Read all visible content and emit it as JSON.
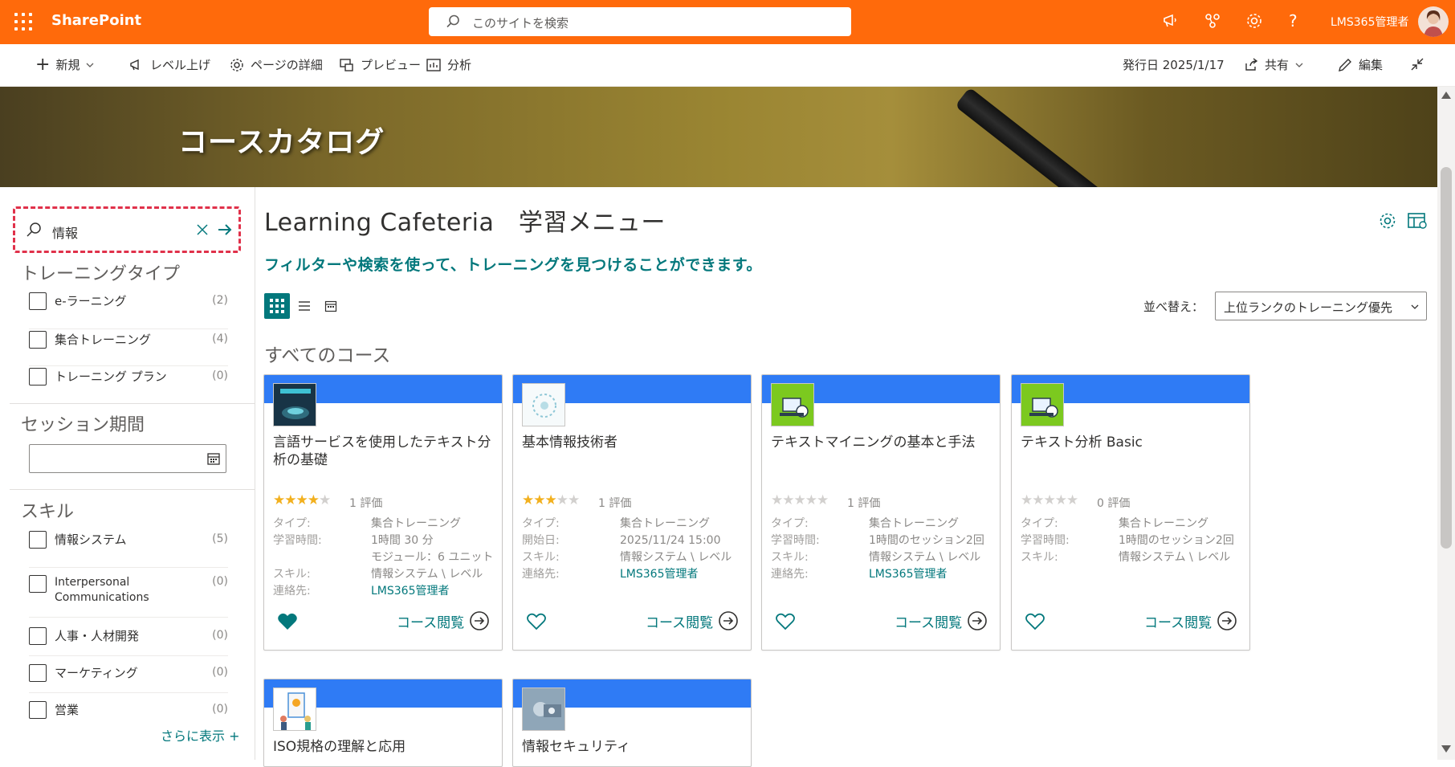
{
  "suitebar": {
    "app_name": "SharePoint",
    "search_placeholder": "このサイトを検索",
    "user_name": "LMS365管理者",
    "icons": [
      "megaphone-icon",
      "network-icon",
      "gear-icon",
      "help-icon"
    ]
  },
  "commandbar": {
    "new_label": "新規",
    "level_up_label": "レベル上げ",
    "page_details_label": "ページの詳細",
    "preview_label": "プレビュー",
    "analytics_label": "分析",
    "published_label": "発行日 2025/1/17",
    "share_label": "共有",
    "edit_label": "編集"
  },
  "hero": {
    "title": "コースカタログ"
  },
  "filters": {
    "search_value": "情報",
    "training_type": {
      "heading": "トレーニングタイプ",
      "items": [
        {
          "label": "e-ラーニング",
          "count": "(2)"
        },
        {
          "label": "集合トレーニング",
          "count": "(4)"
        },
        {
          "label": "トレーニング プラン",
          "count": "(0)"
        }
      ]
    },
    "session_period": {
      "heading": "セッション期間"
    },
    "skills": {
      "heading": "スキル",
      "items": [
        {
          "label": "情報システム",
          "count": "(5)"
        },
        {
          "label": "Interpersonal Communications",
          "count": "(0)"
        },
        {
          "label": "人事・人材開発",
          "count": "(0)"
        },
        {
          "label": "マーケティング",
          "count": "(0)"
        },
        {
          "label": "営業",
          "count": "(0)"
        }
      ],
      "more_label": "さらに表示 +"
    }
  },
  "main": {
    "title": "Learning Cafeteria　学習メニュー",
    "subtitle": "フィルターや検索を使って、トレーニングを見つけることができます。",
    "sort_label": "並べ替え：",
    "sort_value": "上位ランクのトレーニング優先",
    "section_title": "すべてのコース",
    "view_label": "コース閲覧",
    "courses": [
      {
        "title": "言語サービスを使用したテキスト分析の基礎",
        "stars": 4,
        "rating_text": "1 評価",
        "meta": [
          {
            "k": "タイプ:",
            "v": "集合トレーニング"
          },
          {
            "k": "学習時間:",
            "v": "1時間 30 分"
          },
          {
            "k": "",
            "v": "モジュール：6 ユニット"
          },
          {
            "k": "スキル:",
            "v": "情報システム \\ レベル"
          },
          {
            "k": "連絡先:",
            "v": "LMS365管理者"
          }
        ],
        "favorite": true
      },
      {
        "title": "基本情報技術者",
        "stars": 3,
        "rating_text": "1 評価",
        "meta": [
          {
            "k": "タイプ:",
            "v": "集合トレーニング"
          },
          {
            "k": "開始日:",
            "v": "2025/11/24 15:00"
          },
          {
            "k": "スキル:",
            "v": "情報システム \\ レベル"
          },
          {
            "k": "連絡先:",
            "v": "LMS365管理者"
          }
        ],
        "favorite": false
      },
      {
        "title": "テキストマイニングの基本と手法",
        "stars": 0,
        "rating_text": "1 評価",
        "meta": [
          {
            "k": "タイプ:",
            "v": "集合トレーニング"
          },
          {
            "k": "学習時間:",
            "v": "1時間のセッション2回"
          },
          {
            "k": "スキル:",
            "v": "情報システム \\ レベル"
          },
          {
            "k": "連絡先:",
            "v": "LMS365管理者"
          }
        ],
        "favorite": false
      },
      {
        "title": "テキスト分析 Basic",
        "stars": 0,
        "rating_text": "0 評価",
        "meta": [
          {
            "k": "タイプ:",
            "v": "集合トレーニング"
          },
          {
            "k": "学習時間:",
            "v": "1時間のセッション2回"
          },
          {
            "k": "スキル:",
            "v": "情報システム \\ レベル"
          }
        ],
        "favorite": false
      },
      {
        "title": "ISO規格の理解と応用"
      },
      {
        "title": "情報セキュリティ"
      }
    ]
  },
  "colors": {
    "suitebar": "#ff6a0b",
    "accent": "#03787c",
    "card_band": "#2f7bf5",
    "star": "#f2b01e",
    "highlight_border": "#e0314a"
  }
}
